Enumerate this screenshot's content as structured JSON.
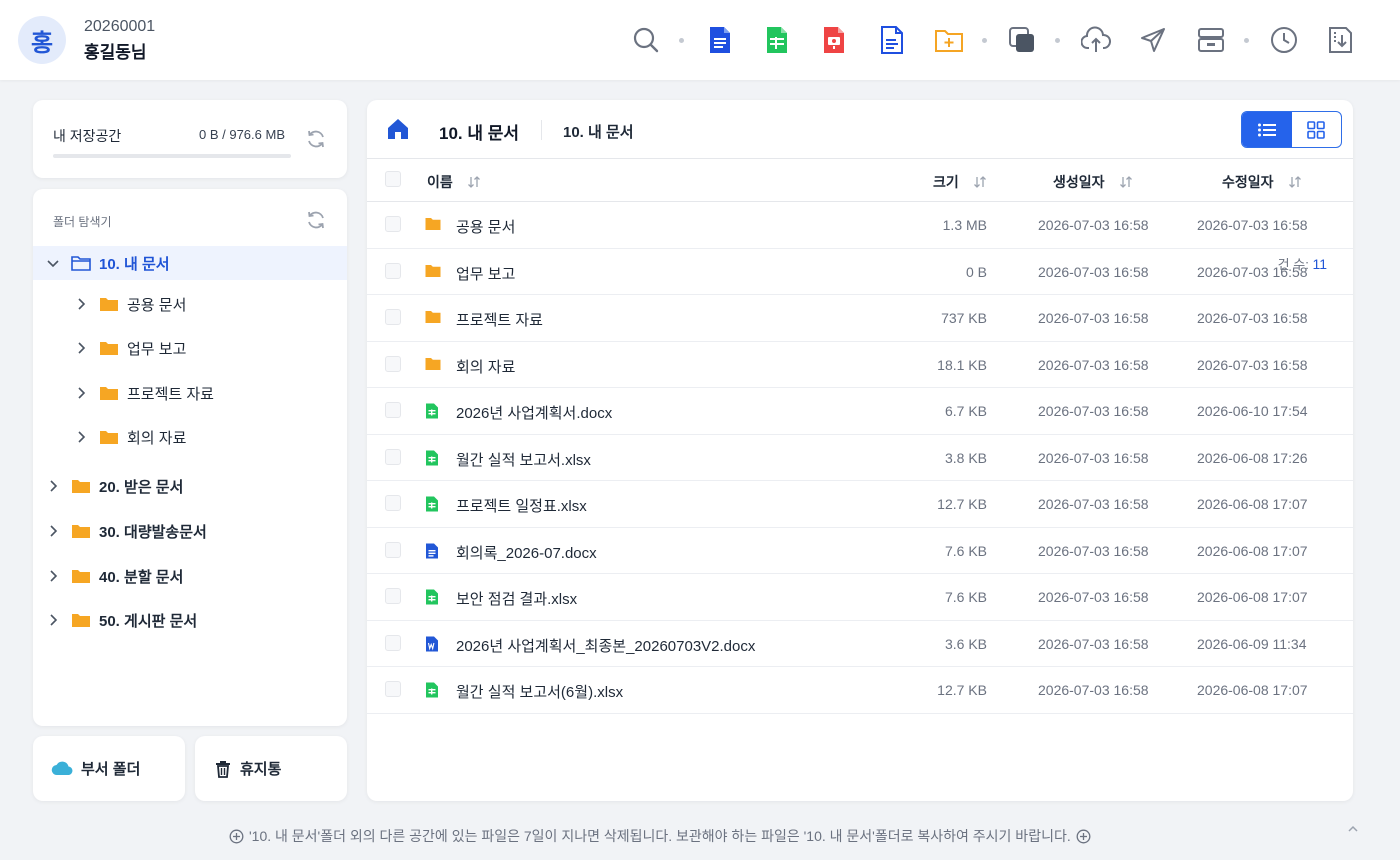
{
  "user": {
    "initial": "홍",
    "id": "20260001",
    "name": "홍길동님"
  },
  "toolbar": [
    {
      "icon": "search-icon"
    },
    {
      "icon": "new-word-doc-icon"
    },
    {
      "icon": "new-sheet-icon"
    },
    {
      "icon": "new-slide-icon"
    },
    {
      "icon": "new-text-doc-icon"
    },
    {
      "icon": "new-folder-icon"
    },
    {
      "icon": "copy-icon"
    },
    {
      "icon": "upload-icon"
    },
    {
      "icon": "send-icon"
    },
    {
      "icon": "archive-icon"
    },
    {
      "icon": "history-icon"
    },
    {
      "icon": "download-zip-icon"
    }
  ],
  "storage": {
    "label": "내 저장공간",
    "value": "0 B / 976.6 MB",
    "used_fraction": 0
  },
  "explorer": {
    "title": "폴더 탐색기",
    "root": "10. 내 문서",
    "children": [
      "공용 문서",
      "업무 보고",
      "프로젝트 자료",
      "회의 자료"
    ],
    "others": [
      "20. 받은 문서",
      "30. 대량발송문서",
      "40. 분할 문서",
      "50. 게시판 문서"
    ]
  },
  "bottom": {
    "dept": "부서 폴더",
    "trash": "휴지통"
  },
  "main": {
    "title": "10. 내 문서",
    "crumb": "10. 내 문서",
    "columns": {
      "name": "이름",
      "size": "크기",
      "created": "생성일자",
      "modified": "수정일자"
    },
    "rows": [
      {
        "type": "folder",
        "name": "공용 문서",
        "size": "1.3 MB",
        "created": "2026-07-03 16:58",
        "modified": "2026-07-03 16:58"
      },
      {
        "type": "folder",
        "name": "업무 보고",
        "size": "0 B",
        "created": "2026-07-03 16:58",
        "modified": "2026-07-03 16:58"
      },
      {
        "type": "folder",
        "name": "프로젝트 자료",
        "size": "737 KB",
        "created": "2026-07-03 16:58",
        "modified": "2026-07-03 16:58"
      },
      {
        "type": "folder",
        "name": "회의 자료",
        "size": "18.1 KB",
        "created": "2026-07-03 16:58",
        "modified": "2026-07-03 16:58"
      },
      {
        "type": "sheet",
        "name": "2026년 사업계획서.docx",
        "size": "6.7 KB",
        "created": "2026-07-03 16:58",
        "modified": "2026-06-10 17:54"
      },
      {
        "type": "sheet",
        "name": "월간 실적 보고서.xlsx",
        "size": "3.8 KB",
        "created": "2026-07-03 16:58",
        "modified": "2026-06-08 17:26"
      },
      {
        "type": "sheet",
        "name": "프로젝트 일정표.xlsx",
        "size": "12.7 KB",
        "created": "2026-07-03 16:58",
        "modified": "2026-06-08 17:07"
      },
      {
        "type": "doc",
        "name": "회의록_2026-07.docx",
        "size": "7.6 KB",
        "created": "2026-07-03 16:58",
        "modified": "2026-06-08 17:07"
      },
      {
        "type": "sheet",
        "name": "보안 점검 결과.xlsx",
        "size": "7.6 KB",
        "created": "2026-07-03 16:58",
        "modified": "2026-06-08 17:07"
      },
      {
        "type": "word",
        "name": "2026년 사업계획서_최종본_20260703V2.docx",
        "size": "3.6 KB",
        "created": "2026-07-03 16:58",
        "modified": "2026-06-09 11:34"
      },
      {
        "type": "sheet",
        "name": "월간 실적 보고서(6월).xlsx",
        "size": "12.7 KB",
        "created": "2026-07-03 16:58",
        "modified": "2026-06-08 17:07"
      }
    ],
    "count_label": "건 수:",
    "count": "11"
  },
  "footer": {
    "note": "'10. 내 문서'폴더 외의 다른 공간에 있는 파일은 7일이 지나면 삭제됩니다. 보관해야 하는 파일은 '10. 내 문서'폴더로 복사하여 주시기 바랍니다."
  },
  "colors": {
    "accent": "#2563eb",
    "folder": "#f6a623",
    "sheet": "#22c55e",
    "doc": "#2257d6",
    "slide": "#ef4444",
    "newfolder": "#f5a524"
  }
}
